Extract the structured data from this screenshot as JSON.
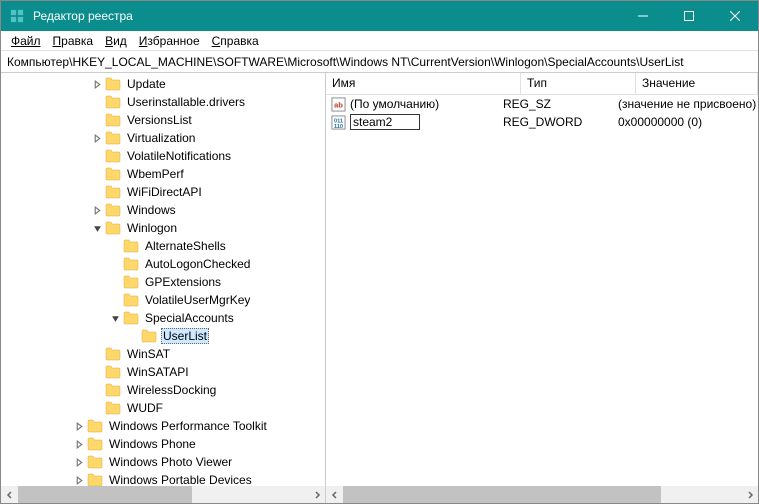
{
  "title": "Редактор реестра",
  "menu": {
    "file": "Файл",
    "edit": "Правка",
    "view": "Вид",
    "favorites": "Избранное",
    "help": "Справка"
  },
  "address": "Компьютер\\HKEY_LOCAL_MACHINE\\SOFTWARE\\Microsoft\\Windows NT\\CurrentVersion\\Winlogon\\SpecialAccounts\\UserList",
  "tree": [
    {
      "depth": 5,
      "exp": "»",
      "label": "Update"
    },
    {
      "depth": 5,
      "exp": "",
      "label": "Userinstallable.drivers"
    },
    {
      "depth": 5,
      "exp": "",
      "label": "VersionsList"
    },
    {
      "depth": 5,
      "exp": "»",
      "label": "Virtualization"
    },
    {
      "depth": 5,
      "exp": "",
      "label": "VolatileNotifications"
    },
    {
      "depth": 5,
      "exp": "",
      "label": "WbemPerf"
    },
    {
      "depth": 5,
      "exp": "",
      "label": "WiFiDirectAPI"
    },
    {
      "depth": 5,
      "exp": "»",
      "label": "Windows"
    },
    {
      "depth": 5,
      "exp": "v",
      "label": "Winlogon"
    },
    {
      "depth": 6,
      "exp": "",
      "label": "AlternateShells"
    },
    {
      "depth": 6,
      "exp": "",
      "label": "AutoLogonChecked"
    },
    {
      "depth": 6,
      "exp": "",
      "label": "GPExtensions"
    },
    {
      "depth": 6,
      "exp": "",
      "label": "VolatileUserMgrKey"
    },
    {
      "depth": 6,
      "exp": "v",
      "label": "SpecialAccounts"
    },
    {
      "depth": 7,
      "exp": "",
      "label": "UserList",
      "selected": true
    },
    {
      "depth": 5,
      "exp": "",
      "label": "WinSAT"
    },
    {
      "depth": 5,
      "exp": "",
      "label": "WinSATAPI"
    },
    {
      "depth": 5,
      "exp": "",
      "label": "WirelessDocking"
    },
    {
      "depth": 5,
      "exp": "",
      "label": "WUDF"
    },
    {
      "depth": 4,
      "exp": "»",
      "label": "Windows Performance Toolkit"
    },
    {
      "depth": 4,
      "exp": "»",
      "label": "Windows Phone"
    },
    {
      "depth": 4,
      "exp": "»",
      "label": "Windows Photo Viewer"
    },
    {
      "depth": 4,
      "exp": "»",
      "label": "Windows Portable Devices"
    }
  ],
  "columns": {
    "name": "Имя",
    "type": "Тип",
    "value": "Значение"
  },
  "rows": [
    {
      "icon": "sz",
      "name": "(По умолчанию)",
      "type": "REG_SZ",
      "value": "(значение не присвоено)"
    },
    {
      "icon": "dw",
      "name": "steam2",
      "editing": true,
      "type": "REG_DWORD",
      "value": "0x00000000 (0)"
    }
  ]
}
